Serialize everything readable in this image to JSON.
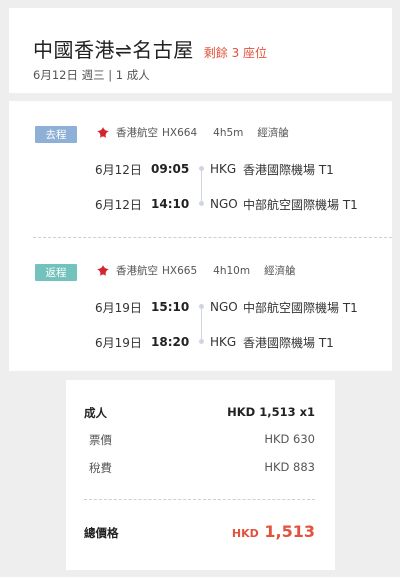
{
  "header": {
    "origin": "中國香港",
    "arrow": "⇌",
    "destination": "名古屋",
    "seats_left": "剩餘 3 座位",
    "subtitle": "6月12日 週三 | 1 成人"
  },
  "outbound": {
    "tag": "去程",
    "airline": "香港航空",
    "flight_no": "HX664",
    "duration": "4h5m",
    "cabin": "經濟艙",
    "depart": {
      "date": "6月12日",
      "time": "09:05",
      "code": "HKG",
      "airport": "香港國際機場 T1"
    },
    "arrive": {
      "date": "6月12日",
      "time": "14:10",
      "code": "NGO",
      "airport": "中部航空國際機場 T1"
    }
  },
  "return": {
    "tag": "返程",
    "airline": "香港航空",
    "flight_no": "HX665",
    "duration": "4h10m",
    "cabin": "經濟艙",
    "depart": {
      "date": "6月19日",
      "time": "15:10",
      "code": "NGO",
      "airport": "中部航空國際機場 T1"
    },
    "arrive": {
      "date": "6月19日",
      "time": "18:20",
      "code": "HKG",
      "airport": "香港國際機場 T1"
    }
  },
  "price": {
    "adult_label": "成人",
    "adult_value": "HKD 1,513 x1",
    "fare_label": "票價",
    "fare_value": "HKD 630",
    "tax_label": "稅費",
    "tax_value": "HKD 883",
    "total_label": "總價格",
    "total_currency": "HKD",
    "total_amount": "1,513"
  },
  "colors": {
    "accent_red": "#e2523c",
    "outbound_tag": "#8fb0d6",
    "return_tag": "#74c2bd"
  }
}
